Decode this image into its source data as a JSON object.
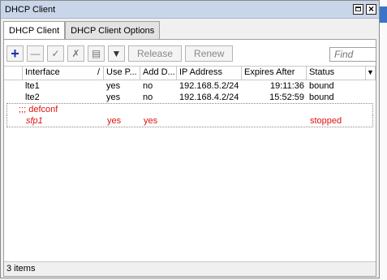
{
  "window": {
    "title": "DHCP Client"
  },
  "tabs": [
    {
      "label": "DHCP Client"
    },
    {
      "label": "DHCP Client Options"
    }
  ],
  "toolbar": {
    "release_label": "Release",
    "renew_label": "Renew",
    "find_placeholder": "Find"
  },
  "columns": [
    "Interface",
    "Use P...",
    "Add D...",
    "IP Address",
    "Expires After",
    "Status"
  ],
  "rows": [
    {
      "interface": "lte1",
      "use_peer": "yes",
      "add_default": "no",
      "ip": "192.168.5.2/24",
      "expires": "19:11:36",
      "status": "bound"
    },
    {
      "interface": "lte2",
      "use_peer": "yes",
      "add_default": "no",
      "ip": "192.168.4.2/24",
      "expires": "15:52:59",
      "status": "bound"
    }
  ],
  "comment": ";;; defconf",
  "disabled_row": {
    "interface": "sfp1",
    "use_peer": "yes",
    "add_default": "yes",
    "ip": "",
    "expires": "",
    "status": "stopped"
  },
  "statusbar": {
    "items": "3 items"
  }
}
